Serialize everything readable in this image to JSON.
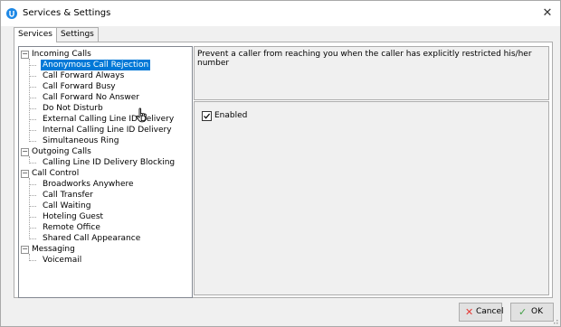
{
  "window": {
    "title": "Services & Settings",
    "close_glyph": "✕"
  },
  "colors": {
    "accent": "#0078d7",
    "app_icon": "#1e88e5",
    "cancel_icon": "#e53935",
    "ok_icon": "#43a047"
  },
  "tabs": [
    {
      "label": "Services",
      "active": true
    },
    {
      "label": "Settings",
      "active": false
    }
  ],
  "tree": [
    {
      "label": "Incoming Calls",
      "toggle": "−",
      "expanded": true,
      "children": [
        {
          "label": "Anonymous Call Rejection",
          "selected": true
        },
        {
          "label": "Call Forward Always"
        },
        {
          "label": "Call Forward Busy"
        },
        {
          "label": "Call Forward No Answer"
        },
        {
          "label": "Do Not Disturb"
        },
        {
          "label": "External Calling Line ID Delivery"
        },
        {
          "label": "Internal Calling Line ID Delivery"
        },
        {
          "label": "Simultaneous Ring"
        }
      ]
    },
    {
      "label": "Outgoing Calls",
      "toggle": "−",
      "expanded": true,
      "children": [
        {
          "label": "Calling Line ID Delivery Blocking"
        }
      ]
    },
    {
      "label": "Call Control",
      "toggle": "−",
      "expanded": true,
      "children": [
        {
          "label": "Broadworks Anywhere"
        },
        {
          "label": "Call Transfer"
        },
        {
          "label": "Call Waiting"
        },
        {
          "label": "Hoteling Guest"
        },
        {
          "label": "Remote Office"
        },
        {
          "label": "Shared Call Appearance"
        }
      ]
    },
    {
      "label": "Messaging",
      "toggle": "−",
      "expanded": true,
      "children": [
        {
          "label": "Voicemail"
        }
      ]
    }
  ],
  "detail": {
    "description": "Prevent a caller from reaching you when the caller has explicitly restricted his/her number",
    "enabled_label": "Enabled",
    "enabled_checked": true,
    "check_glyph": "✓"
  },
  "buttons": {
    "cancel": {
      "label": "Cancel",
      "icon": "x-icon",
      "glyph": "✕"
    },
    "ok": {
      "label": "OK",
      "icon": "check-icon",
      "glyph": "✓"
    }
  }
}
